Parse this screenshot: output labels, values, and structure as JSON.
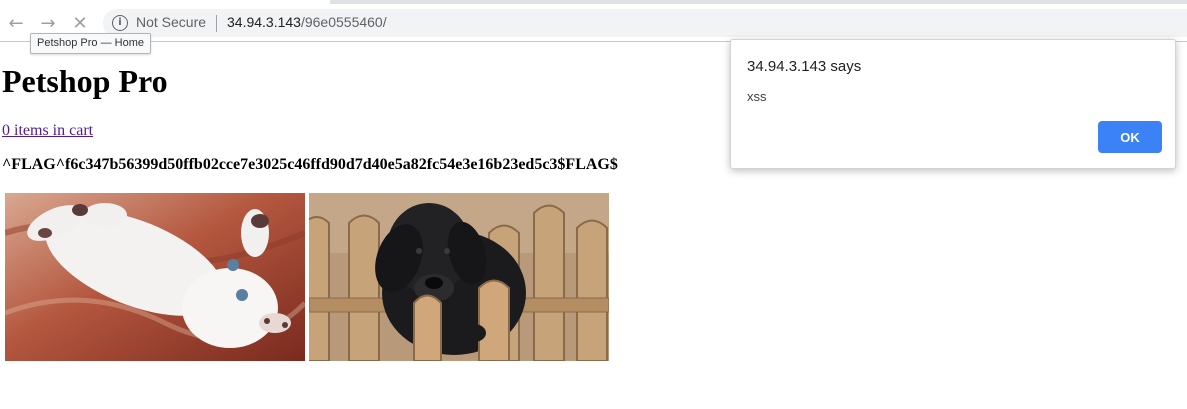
{
  "browser": {
    "nav": {
      "back_icon": "←",
      "forward_icon": "→",
      "stop_icon": "✕"
    },
    "security_label": "Not Secure",
    "url_host": "34.94.3.143",
    "url_path": "/96e0555460/",
    "tab_tooltip": "Petshop Pro — Home"
  },
  "page": {
    "title": "Petshop Pro",
    "cart_link": "0 items in cart",
    "flag": "^FLAG^f6c347b56399d50ffb02cce7e3025c46ffd90d7d40e5a82fc54e3e16b23ed5c3$FLAG$",
    "images": [
      {
        "name": "kitten-image",
        "subject": "white kitten lying on its back"
      },
      {
        "name": "puppy-image",
        "subject": "black puppy behind wooden fence"
      }
    ]
  },
  "dialog": {
    "title": "34.94.3.143 says",
    "message": "xss",
    "ok_label": "OK",
    "ok_color": "#3b82f6"
  }
}
